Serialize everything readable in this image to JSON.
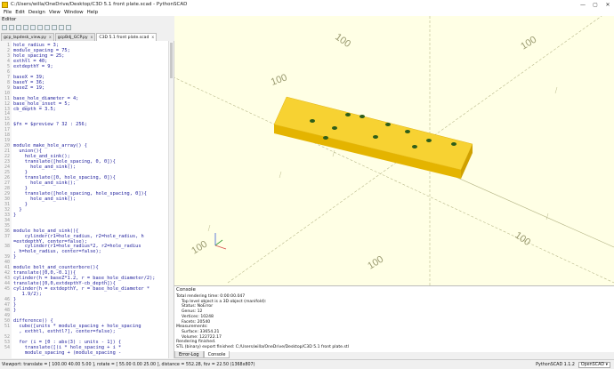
{
  "window": {
    "title": "C:/Users/willa/OneDrive/Desktop/C3D 5.1 front plate.scad - PythonSCAD",
    "min_label": "—",
    "max_label": "▢",
    "close_label": "✕"
  },
  "menu": [
    "File",
    "Edit",
    "Design",
    "View",
    "Window",
    "Help"
  ],
  "editor": {
    "panel_label": "Editor",
    "tabs": [
      {
        "label": "gcp_lapdesk_view.py",
        "close": "x"
      },
      {
        "label": "gcpBdj_GCP.py",
        "close": "x"
      },
      {
        "label": "C3D 5.1 front plate.scad",
        "close": "x"
      }
    ],
    "lines": [
      {
        "n": "1",
        "t": "hole_radius = 3;"
      },
      {
        "n": "2",
        "t": "module_spacing = 75;"
      },
      {
        "n": "3",
        "t": "hole_spacing = 25;"
      },
      {
        "n": "4",
        "t": "exthtl = 40;"
      },
      {
        "n": "5",
        "t": "extdepthY = 9;"
      },
      {
        "n": "6",
        "t": ""
      },
      {
        "n": "7",
        "t": "baseX = 39;"
      },
      {
        "n": "8",
        "t": "baseY = 36;"
      },
      {
        "n": "9",
        "t": "baseZ = 19;"
      },
      {
        "n": "10",
        "t": ""
      },
      {
        "n": "11",
        "t": "base_hole_diameter = 4;"
      },
      {
        "n": "12",
        "t": "base_hole_inset = 5;"
      },
      {
        "n": "13",
        "t": "cb_depth = 3.5;"
      },
      {
        "n": "14",
        "t": ""
      },
      {
        "n": "15",
        "t": ""
      },
      {
        "n": "16",
        "t": "$fn = $preview ? 32 : 256;"
      },
      {
        "n": "17",
        "t": ""
      },
      {
        "n": "18",
        "t": ""
      },
      {
        "n": "19",
        "t": ""
      },
      {
        "n": "20",
        "t": "module make_hole_array() {"
      },
      {
        "n": "21",
        "t": "  union(){"
      },
      {
        "n": "22",
        "t": "    hole_and_sink();"
      },
      {
        "n": "23",
        "t": "    translate([hole_spacing, 0, 0]){"
      },
      {
        "n": "24",
        "t": "      hole_and_sink();"
      },
      {
        "n": "25",
        "t": "    }"
      },
      {
        "n": "26",
        "t": "    translate([0, hole_spacing, 0]){"
      },
      {
        "n": "27",
        "t": "      hole_and_sink();"
      },
      {
        "n": "28",
        "t": "    }"
      },
      {
        "n": "29",
        "t": "    translate([hole_spacing, hole_spacing, 0]){"
      },
      {
        "n": "30",
        "t": "      hole_and_sink();"
      },
      {
        "n": "31",
        "t": "    }"
      },
      {
        "n": "32",
        "t": "  }"
      },
      {
        "n": "33",
        "t": "}"
      },
      {
        "n": "34",
        "t": ""
      },
      {
        "n": "35",
        "t": ""
      },
      {
        "n": "36",
        "t": "module hole_and_sink(){"
      },
      {
        "n": "37",
        "t": "    cylinder(r1=hole_radius, r2=hole_radius, h"
      },
      {
        "n": "",
        "t": "=extdepthY, center=false);"
      },
      {
        "n": "38",
        "t": "    cylinder(r1=hole_radius*2, r2=hole_radius"
      },
      {
        "n": "",
        "t": ", h=hole_radius, center=false);"
      },
      {
        "n": "39",
        "t": "}"
      },
      {
        "n": "40",
        "t": ""
      },
      {
        "n": "41",
        "t": "module bolt_and_counterbore(){"
      },
      {
        "n": "42",
        "t": "translate([0,0,-0.1]){"
      },
      {
        "n": "43",
        "t": "cylinder(h = baseZ*1.2, r = base_hole_diameter/2);"
      },
      {
        "n": "44",
        "t": "translate([0,0,extdepthY-cb_depth]){"
      },
      {
        "n": "45",
        "t": "cylinder(h = extdepthY, r = base_hole_diameter *"
      },
      {
        "n": "",
        "t": "   1.9/2);"
      },
      {
        "n": "46",
        "t": "}"
      },
      {
        "n": "47",
        "t": "}"
      },
      {
        "n": "48",
        "t": "}"
      },
      {
        "n": "49",
        "t": ""
      },
      {
        "n": "50",
        "t": "difference() {"
      },
      {
        "n": "51",
        "t": "  cube([units * module_spacing + hole_spacing"
      },
      {
        "n": "",
        "t": "  , exthtl, exthtl?], center=false);"
      },
      {
        "n": "52",
        "t": ""
      },
      {
        "n": "53",
        "t": "  for (i = [0 : abs(3) : units - 1]) {"
      },
      {
        "n": "54",
        "t": "    translate([(i * hole_spacing + i *"
      },
      {
        "n": "",
        "t": "    module_spacing + (module_spacing -"
      }
    ]
  },
  "viewport": {
    "axis_labels": [
      "100",
      "100",
      "100",
      "100",
      "100",
      "100"
    ],
    "colors": {
      "background": "#ffffe5",
      "plate_top": "#f7d232",
      "plate_front": "#e4b400",
      "plate_side": "#cfa000",
      "hole": "#2e5e1a",
      "axis_x": "#d84a4a",
      "axis_y": "#3a9a3a",
      "axis_z": "#3a5bd8"
    }
  },
  "console": {
    "label": "Console",
    "lines": [
      {
        "t": "Total rendering time: 0:00:00.047",
        "lvl": 0
      },
      {
        "t": "Top level object is a 3D object (manifold):",
        "lvl": 1
      },
      {
        "t": "Status:    NoError",
        "lvl": 1
      },
      {
        "t": "Genus:     12",
        "lvl": 1
      },
      {
        "t": "Vertices:  10248",
        "lvl": 1
      },
      {
        "t": "Facets:    20540",
        "lvl": 1
      },
      {
        "t": "Measurements:",
        "lvl": 0
      },
      {
        "t": "Surface: 33654.21",
        "lvl": 1
      },
      {
        "t": "Volume: 122722.17",
        "lvl": 1
      },
      {
        "t": "Rendering finished.",
        "lvl": 0
      },
      {
        "t": "STL (binary) export finished: C:/Users/willa/OneDrive/Desktop/C3D 5.1 front plate.stl",
        "lvl": 0
      }
    ],
    "tabs": [
      "Error-Log",
      "Console"
    ]
  },
  "status": {
    "text": "Viewport: translate = [ 100.00 40.00 5.00 ], rotate = [ 55.00 0.00 25.00 ], distance = 552.28, fov = 22.50 (1368x807)",
    "version": "PythonSCAD 1.1.2",
    "selector": "OpenSCAD ▾"
  }
}
